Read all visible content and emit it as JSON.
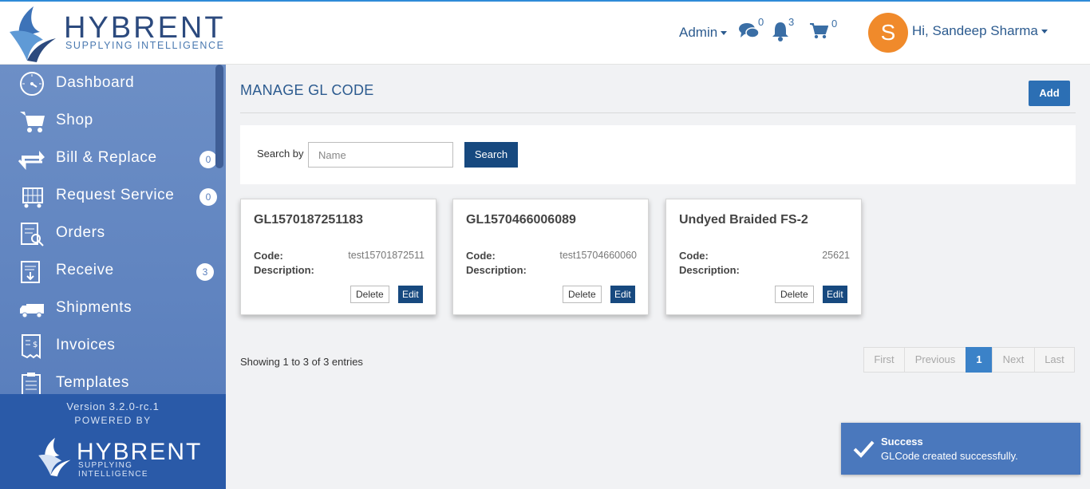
{
  "brand": {
    "name": "HYBRENT",
    "tagline": "SUPPLYING INTELLIGENCE"
  },
  "header": {
    "admin_label": "Admin",
    "chat_count": "0",
    "notification_count": "3",
    "cart_count": "0",
    "avatar_initial": "S",
    "greeting": "Hi, Sandeep Sharma"
  },
  "sidebar": {
    "items": [
      {
        "label": "Dashboard",
        "icon": "dashboard-icon",
        "badge": ""
      },
      {
        "label": "Shop",
        "icon": "cart-icon",
        "badge": ""
      },
      {
        "label": "Bill & Replace",
        "icon": "replace-icon",
        "badge": "0"
      },
      {
        "label": "Request Service",
        "icon": "service-icon",
        "badge": "0"
      },
      {
        "label": "Orders",
        "icon": "orders-icon",
        "badge": ""
      },
      {
        "label": "Receive",
        "icon": "receive-icon",
        "badge": "3"
      },
      {
        "label": "Shipments",
        "icon": "truck-icon",
        "badge": ""
      },
      {
        "label": "Invoices",
        "icon": "invoice-icon",
        "badge": ""
      },
      {
        "label": "Templates",
        "icon": "templates-icon",
        "badge": ""
      }
    ],
    "version": "Version 3.2.0-rc.1",
    "powered_by": "POWERED BY"
  },
  "main": {
    "title": "MANAGE GL CODE",
    "add_label": "Add",
    "search": {
      "label": "Search by",
      "placeholder": "Name",
      "value": "",
      "button": "Search"
    },
    "cards": [
      {
        "title": "GL1570187251183",
        "code_label": "Code:",
        "code": "test15701872511",
        "desc_label": "Description:",
        "description": "",
        "delete_label": "Delete",
        "edit_label": "Edit"
      },
      {
        "title": "GL1570466006089",
        "code_label": "Code:",
        "code": "test15704660060",
        "desc_label": "Description:",
        "description": "",
        "delete_label": "Delete",
        "edit_label": "Edit"
      },
      {
        "title": "Undyed Braided FS-2",
        "code_label": "Code:",
        "code": "25621",
        "desc_label": "Description:",
        "description": "",
        "delete_label": "Delete",
        "edit_label": "Edit"
      }
    ],
    "showing": "Showing 1 to 3 of 3 entries",
    "pagination": {
      "first": "First",
      "previous": "Previous",
      "current": "1",
      "next": "Next",
      "last": "Last"
    }
  },
  "toast": {
    "title": "Success",
    "message": "GLCode created successfully."
  },
  "colors": {
    "accent": "#2c6fb4",
    "dark_button": "#17497f",
    "sidebar": "#6d8fc6",
    "avatar": "#f08a2b",
    "toast": "#4a78bd"
  }
}
